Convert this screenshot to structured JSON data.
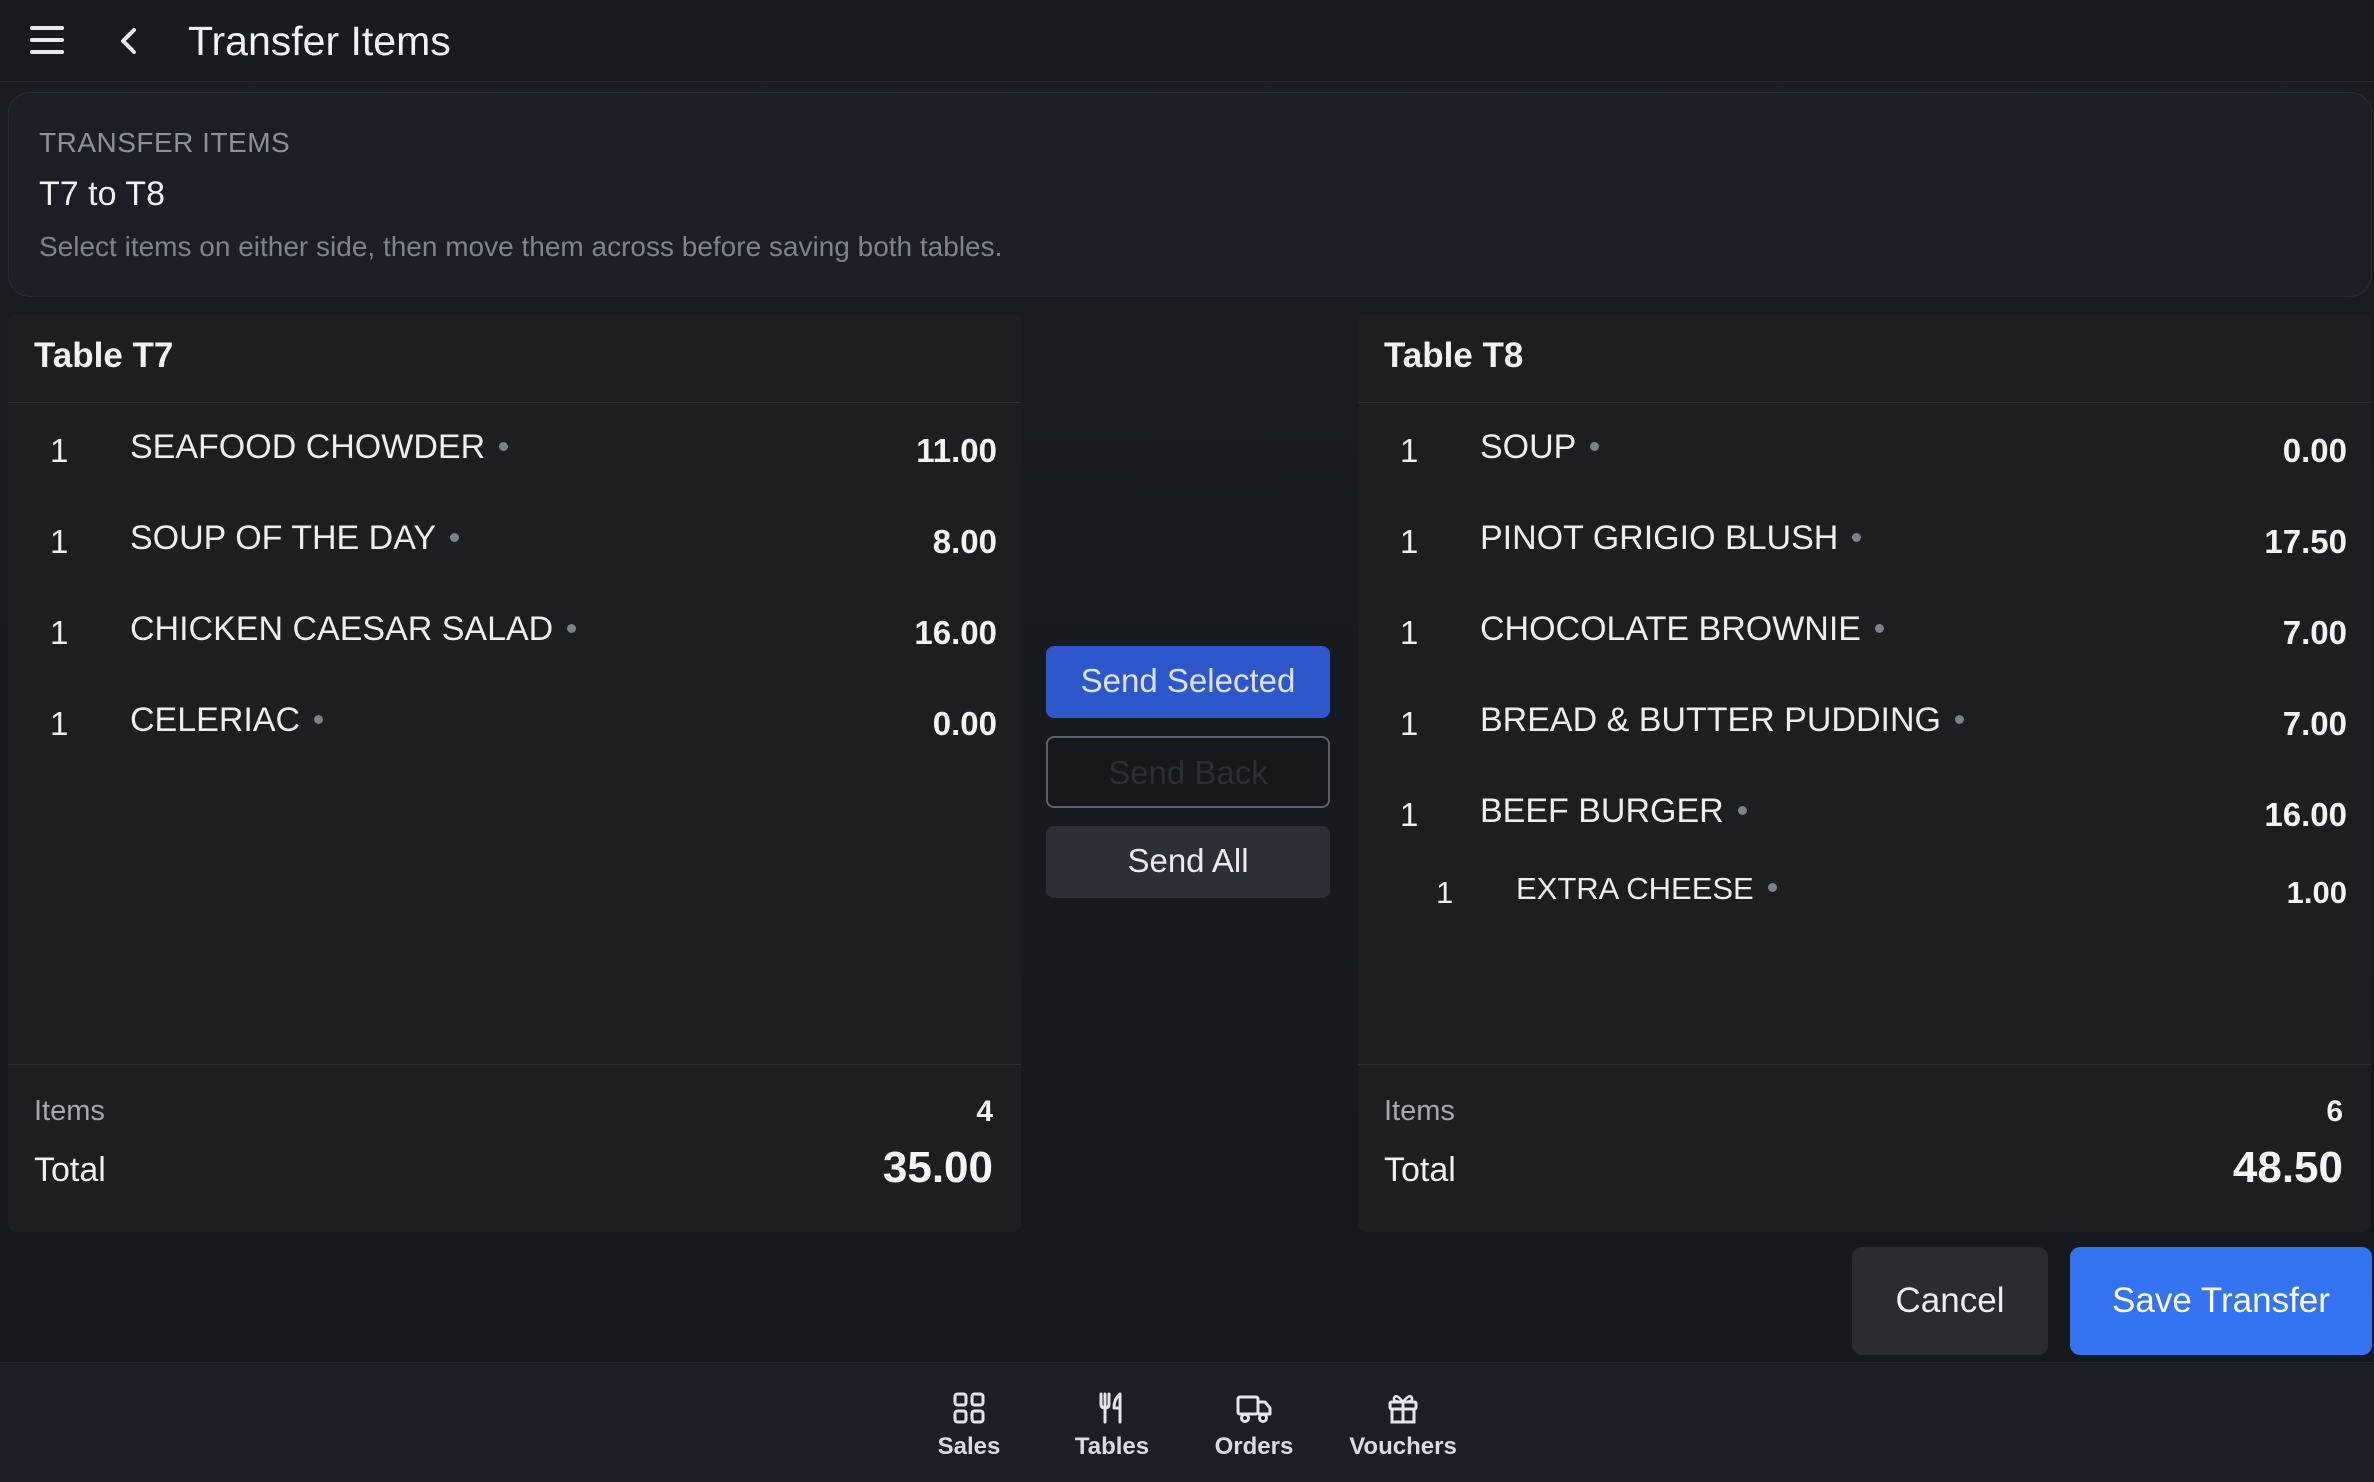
{
  "header": {
    "title": "Transfer Items"
  },
  "transfer": {
    "eyebrow": "TRANSFER ITEMS",
    "route": "T7 to T8",
    "description": "Select items on either side, then move them across before saving both tables."
  },
  "left_table": {
    "title": "Table T7",
    "items": [
      {
        "qty": "1",
        "name": "SEAFOOD CHOWDER",
        "price": "11.00"
      },
      {
        "qty": "1",
        "name": "SOUP OF THE DAY",
        "price": "8.00"
      },
      {
        "qty": "1",
        "name": "CHICKEN CAESAR SALAD",
        "price": "16.00"
      },
      {
        "qty": "1",
        "name": "CELERIAC",
        "price": "0.00"
      }
    ],
    "items_label": "Items",
    "items_count": "4",
    "total_label": "Total",
    "total": "35.00"
  },
  "right_table": {
    "title": "Table T8",
    "items": [
      {
        "qty": "1",
        "name": "SOUP",
        "price": "0.00"
      },
      {
        "qty": "1",
        "name": "PINOT GRIGIO BLUSH",
        "price": "17.50"
      },
      {
        "qty": "1",
        "name": "CHOCOLATE BROWNIE",
        "price": "7.00"
      },
      {
        "qty": "1",
        "name": "BREAD & BUTTER PUDDING",
        "price": "7.00"
      },
      {
        "qty": "1",
        "name": "BEEF BURGER",
        "price": "16.00"
      },
      {
        "qty": "1",
        "name": "EXTRA CHEESE",
        "price": "1.00"
      }
    ],
    "items_label": "Items",
    "items_count": "6",
    "total_label": "Total",
    "total": "48.50"
  },
  "actions": {
    "send_selected": "Send Selected",
    "send_back": "Send Back",
    "send_all": "Send All",
    "cancel": "Cancel",
    "save": "Save Transfer"
  },
  "nav": {
    "sales": "Sales",
    "tables": "Tables",
    "orders": "Orders",
    "vouchers": "Vouchers"
  },
  "icons": {
    "menu": "menu-icon",
    "back": "chevron-left-icon",
    "sales": "grid-icon",
    "tables": "utensils-icon",
    "orders": "truck-icon",
    "vouchers": "gift-icon"
  },
  "colors": {
    "primary": "#3473f2",
    "send_selected": "#2e57cc",
    "background": "#15181d",
    "panel": "#1c1e22"
  }
}
